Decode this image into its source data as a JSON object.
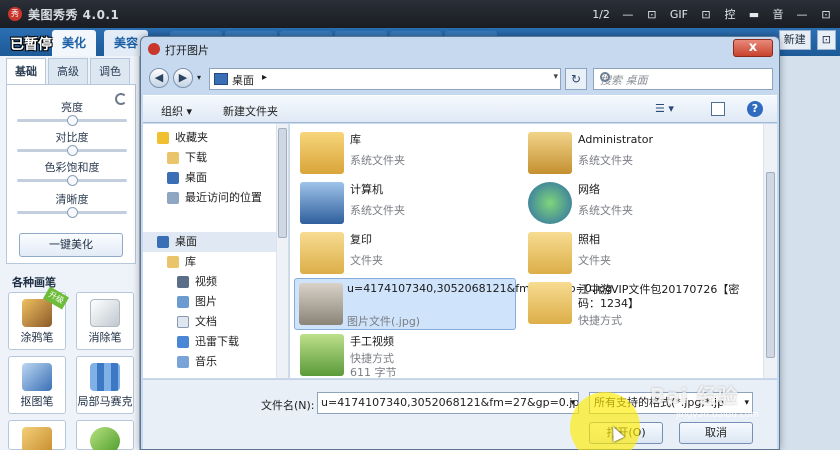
{
  "app": {
    "title": "美图秀秀 4.0.1",
    "logo_text": "秀",
    "toolbar": [
      "1/2",
      "—",
      "⊡",
      "GIF",
      "⊡",
      "控",
      "▬",
      "音",
      "—",
      "⊡"
    ],
    "tabs": [
      {
        "label": "美化"
      },
      {
        "label": "美容"
      }
    ],
    "pause_overlay": "已暂停",
    "right_tools": {
      "new": "新建",
      "toggle": "⊡"
    }
  },
  "left_panel": {
    "subtabs": [
      {
        "label": "基础"
      },
      {
        "label": "高级"
      },
      {
        "label": "调色"
      }
    ],
    "sliders": [
      {
        "label": "亮度"
      },
      {
        "label": "对比度"
      },
      {
        "label": "色彩饱和度"
      },
      {
        "label": "清晰度"
      }
    ],
    "oneclick_label": "一键美化",
    "brush_heading": "各种画笔",
    "new_badge": "升级",
    "brushes": [
      {
        "label": "涂鸦笔"
      },
      {
        "label": "消除笔"
      },
      {
        "label": "抠图笔"
      },
      {
        "label": "局部马赛克"
      }
    ]
  },
  "dialog": {
    "title": "打开图片",
    "close": "x",
    "address": "桌面",
    "search_placeholder": "搜索 桌面",
    "organize": "组织 ▾",
    "new_folder": "新建文件夹",
    "view_glyph": "☰ ▾",
    "help": "?",
    "nav_items": [
      {
        "label": "收藏夹"
      },
      {
        "label": "下载"
      },
      {
        "label": "桌面"
      },
      {
        "label": "最近访问的位置"
      },
      {
        "label": "桌面"
      },
      {
        "label": "库"
      },
      {
        "label": "视频"
      },
      {
        "label": "图片"
      },
      {
        "label": "文档"
      },
      {
        "label": "迅雷下载"
      },
      {
        "label": "音乐"
      }
    ],
    "files": [
      {
        "name": "库",
        "type": "系统文件夹"
      },
      {
        "name": "Administrator",
        "type": "系统文件夹"
      },
      {
        "name": "计算机",
        "type": "系统文件夹"
      },
      {
        "name": "网络",
        "type": "系统文件夹"
      },
      {
        "name": "复印",
        "type": "文件夹"
      },
      {
        "name": "照相",
        "type": "文件夹"
      },
      {
        "name": "u=4174107340,3052068121&fm=27&gp=0.jpg",
        "type": "图片文件(.jpg)"
      },
      {
        "name": "江中游VIP文件包20170726【密码：1234】",
        "type": "快捷方式"
      },
      {
        "name": "手工视频",
        "type": "快捷方式",
        "size": "611 字节"
      }
    ],
    "filename_label": "文件名(N):",
    "filename_value": "u=4174107340,3052068121&fm=27&gp=0.jpg",
    "filter_value": "所有支持的格式(*.jpg;*.jp",
    "open_label": "打开(O)",
    "cancel_label": "取消"
  },
  "watermark": {
    "main": "Bai 经验",
    "sub": "jingyan.baidu.com"
  },
  "colors": {
    "accent": "#1d5a98",
    "dialog_bg": "#c7d9ee",
    "selection": "#cfe3fb",
    "highlight": "#ffeb00"
  }
}
